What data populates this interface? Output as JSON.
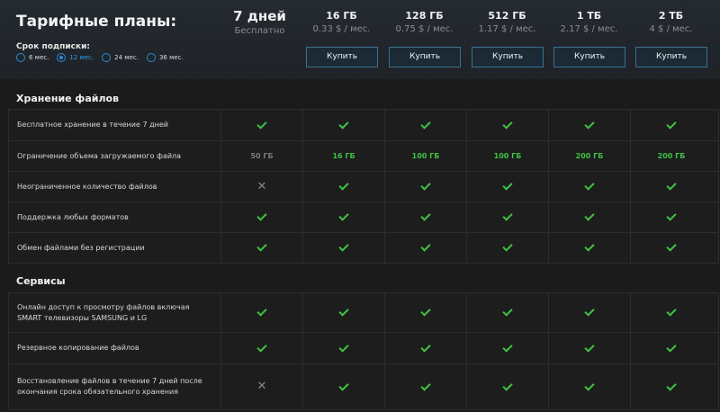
{
  "header": {
    "title": "Тарифные планы:",
    "period_label": "Срок подписки:",
    "periods": [
      "6 мес.",
      "12 мес.",
      "24 мес.",
      "36 мес."
    ],
    "selected_period": "12 мес."
  },
  "plans": [
    {
      "name": "7 дней",
      "price": "Бесплатно",
      "button": ""
    },
    {
      "name": "16 ГБ",
      "price": "0.33 $ / мес.",
      "button": "Купить"
    },
    {
      "name": "128 ГБ",
      "price": "0.75 $ / мес.",
      "button": "Купить"
    },
    {
      "name": "512 ГБ",
      "price": "1.17 $ / мес.",
      "button": "Купить"
    },
    {
      "name": "1 ТБ",
      "price": "2.17 $ / мес.",
      "button": "Купить"
    },
    {
      "name": "2 ТБ",
      "price": "4 $ / мес.",
      "button": "Купить"
    }
  ],
  "sections": [
    {
      "title": "Хранение файлов",
      "rows": [
        {
          "label": "Бесплатное хранение в течение 7 дней",
          "values": [
            "check",
            "check",
            "check",
            "check",
            "check",
            "check"
          ]
        },
        {
          "label": "Ограничение объема загружаемого файла",
          "values": [
            "50 ГБ",
            "16 ГБ",
            "100 ГБ",
            "100 ГБ",
            "200 ГБ",
            "200 ГБ"
          ]
        },
        {
          "label": "Неограниченное количество файлов",
          "values": [
            "cross",
            "check",
            "check",
            "check",
            "check",
            "check"
          ]
        },
        {
          "label": "Поддержка любых форматов",
          "values": [
            "check",
            "check",
            "check",
            "check",
            "check",
            "check"
          ]
        },
        {
          "label": "Обмен файлами без регистрации",
          "values": [
            "check",
            "check",
            "check",
            "check",
            "check",
            "check"
          ]
        }
      ]
    },
    {
      "title": "Сервисы",
      "rows": [
        {
          "label": "Онлайн доступ к просмотру файлов включая SMART телевизоры SAMSUNG и LG",
          "values": [
            "check",
            "check",
            "check",
            "check",
            "check",
            "check"
          ]
        },
        {
          "label": "Резервное копирование файлов",
          "values": [
            "check",
            "check",
            "check",
            "check",
            "check",
            "check"
          ]
        },
        {
          "label": "Восстановление файлов в течение 7 дней после окончания срока обязательного хранения",
          "values": [
            "cross",
            "check",
            "check",
            "check",
            "check",
            "check"
          ]
        }
      ]
    }
  ],
  "colors": {
    "accent": "#2c8ad6",
    "check": "#3fc243",
    "background": "#1b1b1b"
  }
}
